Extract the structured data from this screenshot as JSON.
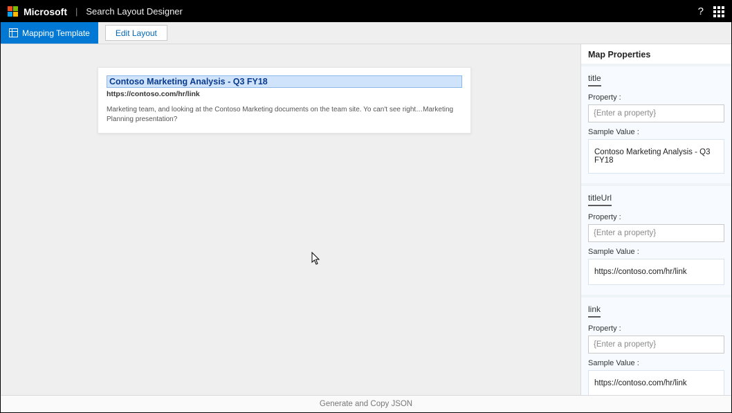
{
  "header": {
    "brand": "Microsoft",
    "app_name": "Search Layout Designer"
  },
  "toolbar": {
    "mapping_tab": "Mapping Template",
    "edit_layout": "Edit Layout"
  },
  "preview": {
    "title": "Contoso Marketing Analysis - Q3 FY18",
    "url": "https://contoso.com/hr/link",
    "snippet": "Marketing team, and looking at the Contoso Marketing documents on the team site. Yo can't see right…Marketing Planning presentation?"
  },
  "panel": {
    "heading": "Map Properties",
    "property_label": "Property :",
    "sample_label": "Sample Value :",
    "property_placeholder": "{Enter a property}",
    "blocks": [
      {
        "name": "title",
        "sample": "Contoso Marketing Analysis - Q3 FY18"
      },
      {
        "name": "titleUrl",
        "sample": "https://contoso.com/hr/link"
      },
      {
        "name": "link",
        "sample": "https://contoso.com/hr/link"
      }
    ]
  },
  "footer": {
    "generate": "Generate and Copy JSON"
  }
}
